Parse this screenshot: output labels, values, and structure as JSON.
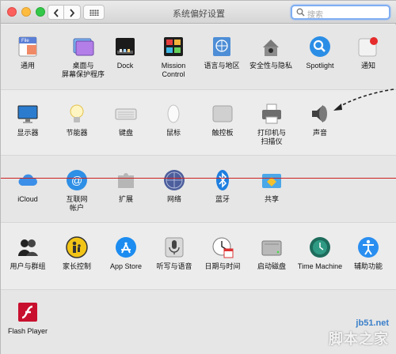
{
  "window": {
    "title": "系统偏好设置"
  },
  "search": {
    "placeholder": "搜索"
  },
  "rows": [
    {
      "items": [
        {
          "label": "通用",
          "icon": "general-icon"
        },
        {
          "label": "桌面与\n屏幕保护程序",
          "icon": "desktop-screensaver-icon"
        },
        {
          "label": "Dock",
          "icon": "dock-icon"
        },
        {
          "label": "Mission\nControl",
          "icon": "mission-control-icon"
        },
        {
          "label": "语言与地区",
          "icon": "language-region-icon"
        },
        {
          "label": "安全性与隐私",
          "icon": "security-privacy-icon"
        },
        {
          "label": "Spotlight",
          "icon": "spotlight-icon"
        },
        {
          "label": "通知",
          "icon": "notifications-icon"
        }
      ]
    },
    {
      "items": [
        {
          "label": "显示器",
          "icon": "displays-icon"
        },
        {
          "label": "节能器",
          "icon": "energy-saver-icon"
        },
        {
          "label": "键盘",
          "icon": "keyboard-icon"
        },
        {
          "label": "鼠标",
          "icon": "mouse-icon"
        },
        {
          "label": "触控板",
          "icon": "trackpad-icon"
        },
        {
          "label": "打印机与\n扫描仪",
          "icon": "printer-scanner-icon"
        },
        {
          "label": "声音",
          "icon": "sound-icon"
        }
      ]
    },
    {
      "items": [
        {
          "label": "iCloud",
          "icon": "icloud-icon"
        },
        {
          "label": "互联网\n帐户",
          "icon": "internet-accounts-icon"
        },
        {
          "label": "扩展",
          "icon": "extensions-icon"
        },
        {
          "label": "网络",
          "icon": "network-icon"
        },
        {
          "label": "蓝牙",
          "icon": "bluetooth-icon"
        },
        {
          "label": "共享",
          "icon": "sharing-icon"
        }
      ]
    },
    {
      "items": [
        {
          "label": "用户与群组",
          "icon": "users-groups-icon"
        },
        {
          "label": "家长控制",
          "icon": "parental-controls-icon"
        },
        {
          "label": "App Store",
          "icon": "app-store-icon"
        },
        {
          "label": "听写与语音",
          "icon": "dictation-speech-icon"
        },
        {
          "label": "日期与时间",
          "icon": "date-time-icon"
        },
        {
          "label": "启动磁盘",
          "icon": "startup-disk-icon"
        },
        {
          "label": "Time Machine",
          "icon": "time-machine-icon"
        },
        {
          "label": "辅助功能",
          "icon": "accessibility-icon"
        }
      ]
    },
    {
      "items": [
        {
          "label": "Flash Player",
          "icon": "flash-player-icon"
        }
      ]
    }
  ],
  "watermark": {
    "site": "jb51.net",
    "brand": "脚本之家"
  },
  "colors": {
    "search_focus": "#7faef3",
    "annotation_line": "#cc1f1f"
  }
}
